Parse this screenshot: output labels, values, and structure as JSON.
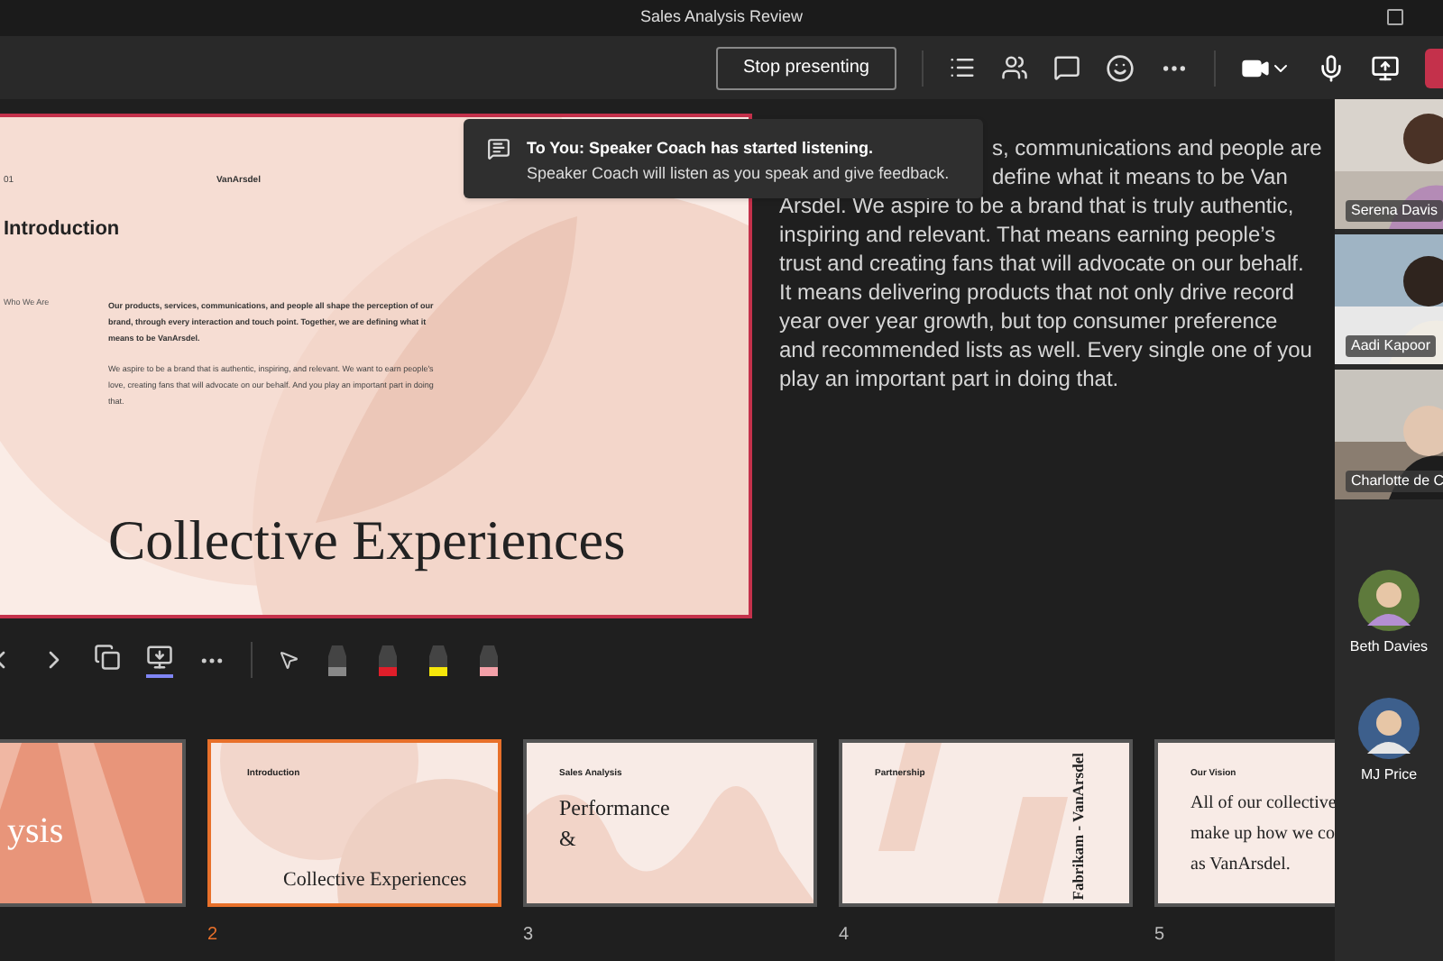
{
  "window": {
    "title": "Sales Analysis Review"
  },
  "toolbar": {
    "stop_button": "Stop presenting"
  },
  "toast": {
    "title": "To You: Speaker Coach has started listening.",
    "message": "Speaker Coach will listen as you speak and give feedback."
  },
  "slide": {
    "number": "01",
    "brand": "VanArsdel",
    "heading": "Introduction",
    "side_label": "Who We Are",
    "lead": "Our products, services, communications, and people all shape the perception of our brand, through every interaction and touch point. Together, we are defining what it means to be VanArsdel.",
    "body": "We aspire to be a brand that is authentic, inspiring, and relevant. We want to earn people's love, creating fans that will advocate on our behalf. And you play an important part in doing that.",
    "title": "Collective Experiences"
  },
  "notes": {
    "lines": [
      "s, communications and people are",
      "define what it means to be Van",
      "Arsdel. We aspire to be a brand that is truly authentic,",
      "inspiring and relevant. That means earning people’s",
      "trust and creating fans that will advocate on our behalf.",
      "It means delivering products that not only drive record",
      "year over year growth, but top consumer preference",
      "and recommended lists as well. Every single one of you",
      "play an important part in doing that."
    ]
  },
  "view_buttons": [
    {
      "selected": false
    },
    {
      "selected": true
    }
  ],
  "thumbnails": [
    {
      "kind": "cover",
      "selected": false,
      "title": "ysis"
    },
    {
      "kind": "intro",
      "selected": true,
      "number": "2",
      "heading": "Introduction",
      "title": "Collective Experiences"
    },
    {
      "kind": "performance",
      "selected": false,
      "number": "3",
      "heading": "Sales Analysis",
      "title": "Performance",
      "subtitle": "&"
    },
    {
      "kind": "partnership",
      "selected": false,
      "number": "4",
      "heading": "Partnership",
      "title": "Fabrikam - VanArsdel"
    },
    {
      "kind": "vision",
      "selected": false,
      "number": "5",
      "heading": "Our Vision",
      "lines": [
        "All of our collective",
        "make up how we co",
        "as VanArsdel."
      ]
    }
  ],
  "participants": {
    "videos": [
      {
        "name": "Serena Davis"
      },
      {
        "name": "Aadi Kapoor"
      },
      {
        "name": "Charlotte de C"
      }
    ],
    "avatars": [
      {
        "name": "Beth Davies"
      },
      {
        "name": "MJ Price"
      }
    ]
  }
}
